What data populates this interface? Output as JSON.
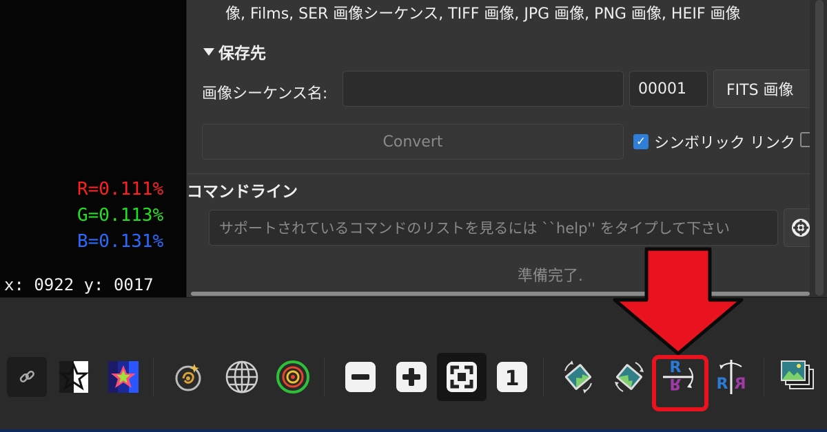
{
  "readout": {
    "r": "R=0.111%",
    "g": "G=0.113%",
    "b": "B=0.131%",
    "coords": "x: 0922 y: 0017",
    "colors": {
      "r": "#ff2020",
      "g": "#22e022",
      "b": "#2a6bff"
    }
  },
  "convert_dialog": {
    "formats_line": "像, Films, SER 画像シーケンス, TIFF 画像, JPG 画像, PNG 画像, HEIF 画像",
    "destination": {
      "section_title": "保存先",
      "sequence_name_label": "画像シーケンス名:",
      "sequence_name_value": "",
      "start_number": "00001",
      "output_format": "FITS 画像"
    },
    "convert_button": "Convert",
    "symbolic_link_label": "シンボリック リンク",
    "symbolic_link_checked": true
  },
  "command_line": {
    "title": "コマンドライン",
    "placeholder": "サポートされているコマンドのリストを見るには ``help'' をタイプして下さい",
    "status": "準備完了."
  },
  "toolbar": {
    "highlighted_tool": "mirror-x-icon",
    "annotation_color": "#e8131f",
    "actual_size_label": "1"
  }
}
